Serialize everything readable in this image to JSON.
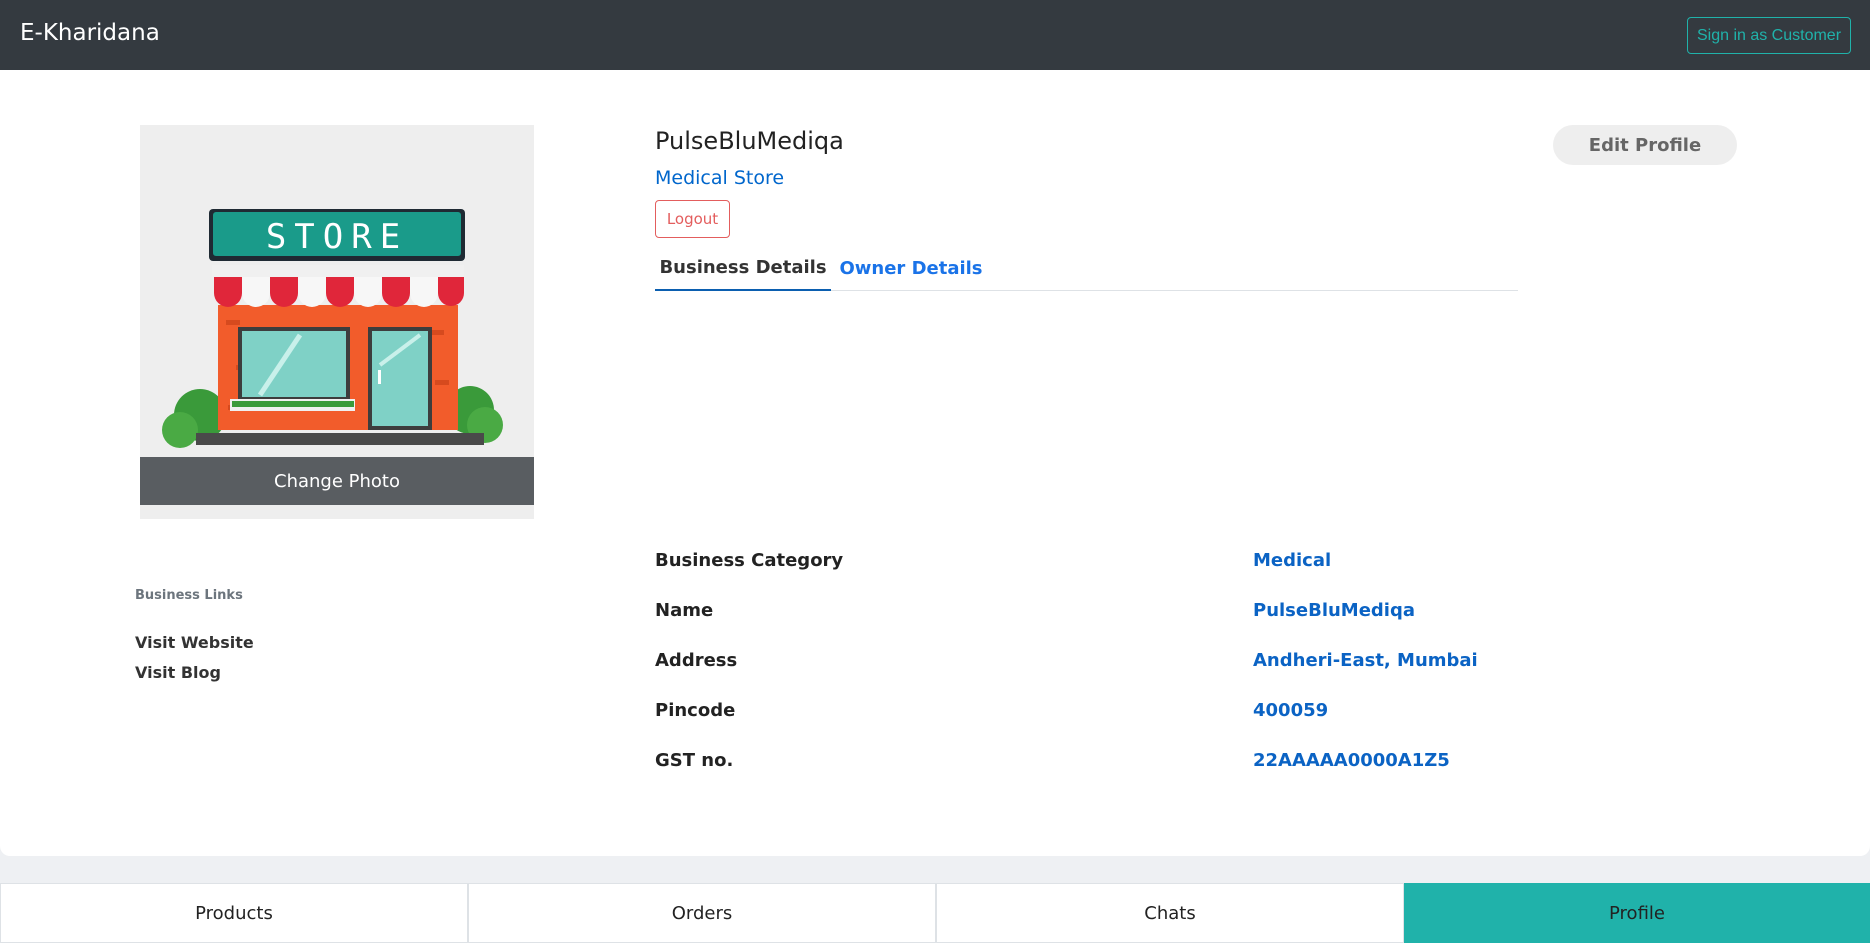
{
  "header": {
    "brand": "E-Kharidana",
    "signin_label": "Sign in as Customer"
  },
  "profile": {
    "store_sign": "STORE",
    "change_photo_label": "Change Photo",
    "store_name": "PulseBluMediqa",
    "store_type": "Medical Store",
    "logout_label": "Logout",
    "edit_label": "Edit Profile"
  },
  "links": {
    "heading": "Business Links",
    "items": [
      {
        "label": "Visit Website"
      },
      {
        "label": "Visit Blog"
      }
    ]
  },
  "tabs": [
    {
      "label": "Business Details",
      "active": true
    },
    {
      "label": "Owner Details",
      "active": false
    }
  ],
  "details": [
    {
      "label": "Business Category",
      "value": "Medical"
    },
    {
      "label": "Name",
      "value": "PulseBluMediqa"
    },
    {
      "label": "Address",
      "value": "Andheri-East, Mumbai"
    },
    {
      "label": "Pincode",
      "value": "400059"
    },
    {
      "label": "GST no.",
      "value": "22AAAAA0000A1Z5"
    }
  ],
  "bottom_nav": [
    {
      "label": "Products",
      "active": false
    },
    {
      "label": "Orders",
      "active": false
    },
    {
      "label": "Chats",
      "active": false
    },
    {
      "label": "Profile",
      "active": true
    }
  ],
  "colors": {
    "navbar": "#343a40",
    "accent_teal": "#20b2aa",
    "link_blue": "#0b63c4",
    "logout_red": "#e35d5d"
  }
}
